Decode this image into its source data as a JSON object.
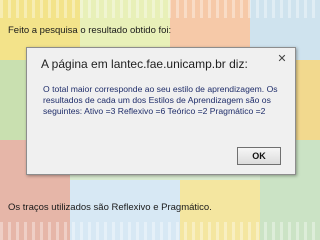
{
  "captions": {
    "top": "Feito a pesquisa o resultado obtido foi:",
    "bottom": "Os traços utilizados são Reflexivo e Pragmático."
  },
  "dialog": {
    "title": "A página em lantec.fae.unicamp.br diz:",
    "message": "O total maior corresponde ao seu estilo de aprendizagem. Os resultados de cada um dos Estilos de Aprendizagem são os seguintes:  Ativo =3 Reflexivo =6 Teórico =2 Pragmático =2",
    "ok_label": "OK",
    "close_icon": "close-icon"
  }
}
